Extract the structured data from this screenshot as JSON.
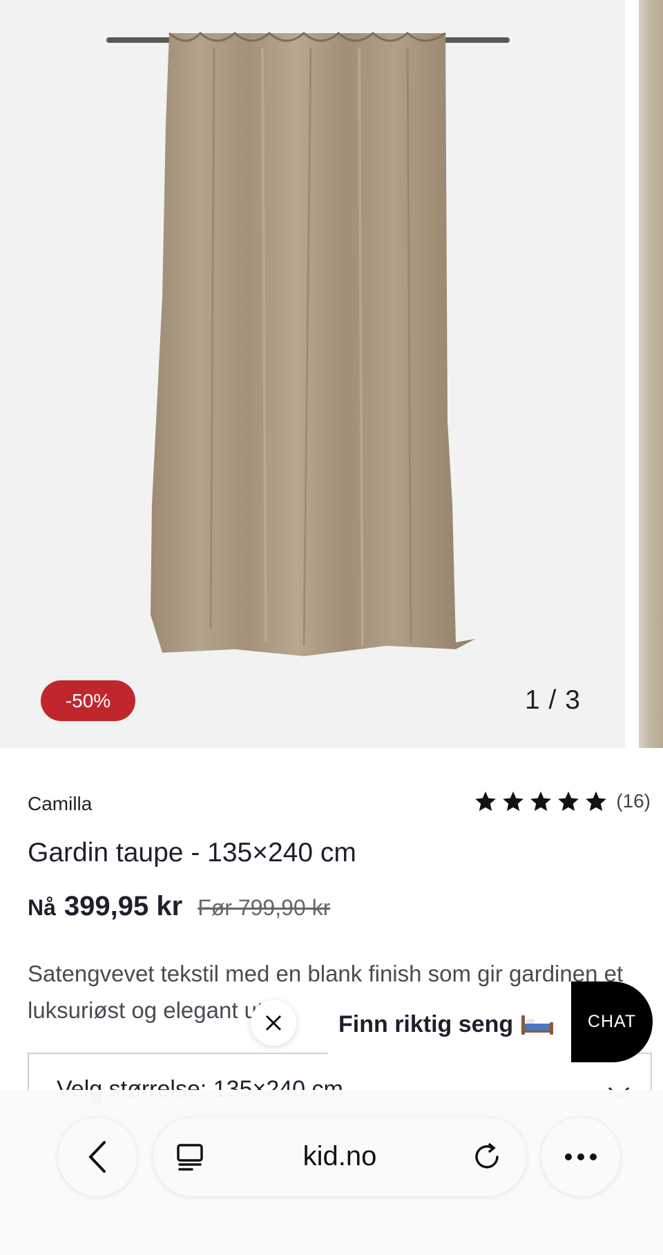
{
  "gallery": {
    "badge": "-50%",
    "counter": "1 / 3"
  },
  "product": {
    "brand": "Camilla",
    "rating": {
      "stars": 5,
      "count": "(16)"
    },
    "title": "Gardin taupe - 135×240 cm",
    "price_now_label": "Nå",
    "price_now": "399,95 kr",
    "price_before": "Før 799,90 kr",
    "description": "Satengvevet tekstil med en blank finish som gir gardinen et luksuriøst og elegant utt",
    "size_select_label": "Velg størrelse: 135×240 cm"
  },
  "promo": {
    "text": "Finn riktig seng",
    "icon": "bed-icon"
  },
  "chat": {
    "label": "CHAT"
  },
  "browser": {
    "address": "kid.no"
  },
  "colors": {
    "sale_badge": "#c0272d",
    "curtain": "#a8977e",
    "chat_bg": "#000000"
  }
}
